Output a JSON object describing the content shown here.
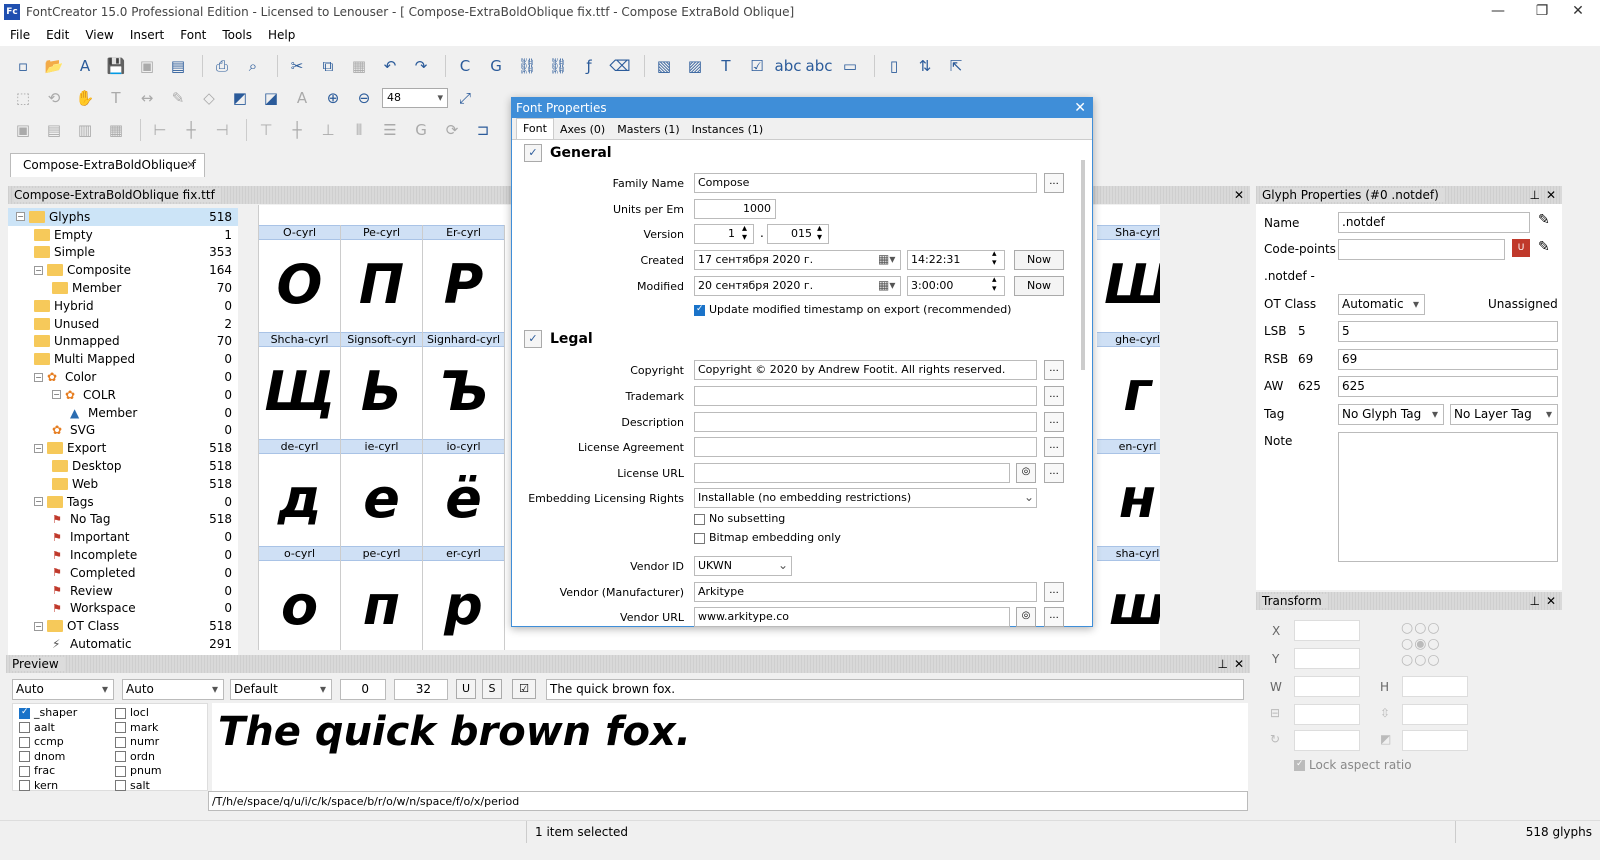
{
  "window": {
    "title": "FontCreator 15.0 Professional Edition - Licensed to Lenouser - [ Compose-ExtraBoldOblique fix.ttf - Compose ExtraBold Oblique]"
  },
  "menu": [
    "File",
    "Edit",
    "View",
    "Insert",
    "Font",
    "Tools",
    "Help"
  ],
  "toolbar": {
    "zoom": "48"
  },
  "doc_tab": {
    "label": "Compose-ExtraBoldOblique f"
  },
  "tree": {
    "header": "Compose-ExtraBoldOblique fix.ttf",
    "items": [
      {
        "label": "Glyphs",
        "count": "518"
      },
      {
        "label": "Empty",
        "count": "1"
      },
      {
        "label": "Simple",
        "count": "353"
      },
      {
        "label": "Composite",
        "count": "164"
      },
      {
        "label": "Member",
        "count": "70"
      },
      {
        "label": "Hybrid",
        "count": "0"
      },
      {
        "label": "Unused",
        "count": "2"
      },
      {
        "label": "Unmapped",
        "count": "70"
      },
      {
        "label": "Multi Mapped",
        "count": "0"
      },
      {
        "label": "Color",
        "count": "0"
      },
      {
        "label": "COLR",
        "count": "0"
      },
      {
        "label": "Member",
        "count": "0"
      },
      {
        "label": "SVG",
        "count": "0"
      },
      {
        "label": "Export",
        "count": "518"
      },
      {
        "label": "Desktop",
        "count": "518"
      },
      {
        "label": "Web",
        "count": "518"
      },
      {
        "label": "Tags",
        "count": "0"
      },
      {
        "label": "No Tag",
        "count": "518"
      },
      {
        "label": "Important",
        "count": "0"
      },
      {
        "label": "Incomplete",
        "count": "0"
      },
      {
        "label": "Completed",
        "count": "0"
      },
      {
        "label": "Review",
        "count": "0"
      },
      {
        "label": "Workspace",
        "count": "0"
      },
      {
        "label": "OT Class",
        "count": "518"
      },
      {
        "label": "Automatic",
        "count": "291"
      }
    ]
  },
  "glyph_grid": {
    "rows": [
      [
        {
          "name": "O-cyrl",
          "ch": "О"
        },
        {
          "name": "Pe-cyrl",
          "ch": "П"
        },
        {
          "name": "Er-cyrl",
          "ch": "Р"
        },
        {
          "name": "Sha-cyrl",
          "ch": "Ш"
        }
      ],
      [
        {
          "name": "Shcha-cyrl",
          "ch": "Щ"
        },
        {
          "name": "Signsoft-cyrl",
          "ch": "Ь"
        },
        {
          "name": "Signhard-cyrl",
          "ch": "Ъ"
        },
        {
          "name": "ghe-cyrl",
          "ch": "г"
        }
      ],
      [
        {
          "name": "de-cyrl",
          "ch": "д"
        },
        {
          "name": "ie-cyrl",
          "ch": "е"
        },
        {
          "name": "io-cyrl",
          "ch": "ё"
        },
        {
          "name": "en-cyrl",
          "ch": "н"
        }
      ],
      [
        {
          "name": "o-cyrl",
          "ch": "о"
        },
        {
          "name": "pe-cyrl",
          "ch": "п"
        },
        {
          "name": "er-cyrl",
          "ch": "р"
        },
        {
          "name": "sha-cyrl",
          "ch": "ш"
        }
      ]
    ]
  },
  "dialog": {
    "title": "Font Properties",
    "tabs": [
      "Font",
      "Axes (0)",
      "Masters (1)",
      "Instances (1)"
    ],
    "general": {
      "title": "General",
      "family_label": "Family Name",
      "family": "Compose",
      "upm_label": "Units per Em",
      "upm": "1000",
      "version_label": "Version",
      "version_major": "1",
      "version_minor": "015",
      "created_label": "Created",
      "created_date": "17 сентября 2020 г.",
      "created_time": "14:22:31",
      "modified_label": "Modified",
      "modified_date": "20 сентября 2020 г.",
      "modified_time": "3:00:00",
      "now": "Now",
      "update_ts": "Update modified timestamp on export (recommended)"
    },
    "legal": {
      "title": "Legal",
      "copyright_label": "Copyright",
      "copyright": "Copyright © 2020 by Andrew Footit. All rights reserved.",
      "trademark_label": "Trademark",
      "description_label": "Description",
      "license_label": "License Agreement",
      "license_url_label": "License URL",
      "embedding_label": "Embedding Licensing Rights",
      "embedding": "Installable (no embedding restrictions)",
      "no_subsetting": "No subsetting",
      "bitmap_only": "Bitmap embedding only",
      "vendor_id_label": "Vendor ID",
      "vendor_id": "UKWN",
      "vendor_label": "Vendor (Manufacturer)",
      "vendor": "Arkitype",
      "vendor_url_label": "Vendor URL",
      "vendor_url": "www.arkitype.co"
    },
    "dots": "..."
  },
  "glyph_props": {
    "title": "Glyph Properties (#0 .notdef)",
    "name_label": "Name",
    "name": ".notdef",
    "cp_label": "Code-points",
    "notdef": ".notdef -",
    "otclass_label": "OT Class",
    "otclass": "Automatic",
    "unassigned": "Unassigned",
    "lsb_label": "LSB",
    "lsb": "5",
    "rsb_label": "RSB",
    "rsb": "69",
    "aw_label": "AW",
    "aw": "625",
    "tag_label": "Tag",
    "tag": "No Glyph Tag",
    "layer_tag": "No Layer Tag",
    "note_label": "Note"
  },
  "transform": {
    "title": "Transform",
    "x": "X",
    "y": "Y",
    "w": "W",
    "h": "H",
    "lock": "Lock aspect ratio"
  },
  "preview": {
    "title": "Preview",
    "sel1": "Auto",
    "sel2": "Auto",
    "sel3": "Default",
    "num1": "0",
    "num2": "32",
    "u": "U",
    "s": "S",
    "text": "The quick brown fox.",
    "sample": "The quick brown fox.",
    "glyph_string": "/T/h/e/space/q/u/i/c/k/space/b/r/o/w/n/space/f/o/x/period",
    "features_left": [
      "_shaper",
      "aalt",
      "ccmp",
      "dnom",
      "frac",
      "kern"
    ],
    "features_right": [
      "locl",
      "mark",
      "numr",
      "ordn",
      "pnum",
      "salt"
    ]
  },
  "status": {
    "selected": "1 item selected",
    "glyphs": "518 glyphs"
  }
}
